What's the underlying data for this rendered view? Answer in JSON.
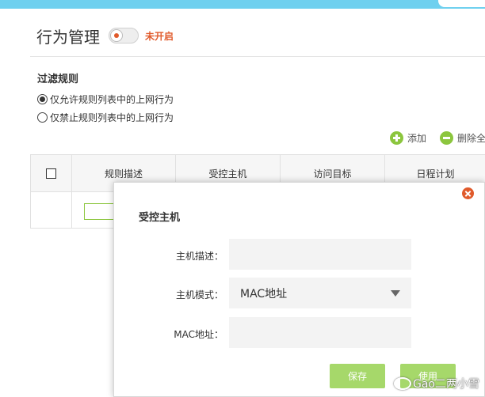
{
  "header": {
    "title": "行为管理",
    "toggle_state": "未开启"
  },
  "filter": {
    "title": "过滤规则",
    "options": [
      {
        "label": "仅允许规则列表中的上网行为",
        "checked": true
      },
      {
        "label": "仅禁止规则列表中的上网行为",
        "checked": false
      }
    ]
  },
  "actions": {
    "add": "添加",
    "delete": "删除全"
  },
  "table": {
    "columns": [
      "规则描述",
      "受控主机",
      "访问目标",
      "日程计划"
    ]
  },
  "modal": {
    "title": "受控主机",
    "fields": [
      {
        "label": "主机描述：",
        "value": ""
      },
      {
        "label": "主机模式：",
        "value": "MAC地址"
      },
      {
        "label": "MAC地址：",
        "value": ""
      }
    ],
    "save_label": "保存",
    "apply_label": "使用"
  },
  "watermark": "Gao二两小雪",
  "colors": {
    "accent_green": "#8cc63e",
    "accent_orange": "#e05a2b",
    "topbar": "#6fd0ef"
  }
}
